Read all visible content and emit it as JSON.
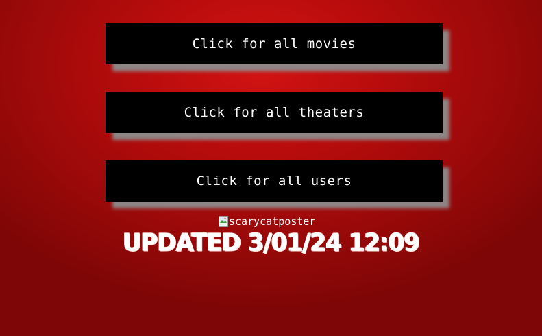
{
  "buttons": {
    "movies": "Click for all movies",
    "theaters": "Click for all theaters",
    "users": "Click for all users"
  },
  "poster": {
    "alt_text": "scarycatposter",
    "icon": "broken-image-icon"
  },
  "updated_text": "UPDATED 3/01/24 12:09",
  "colors": {
    "background": "#b80c0c",
    "button_bg": "#000000",
    "button_text": "#ffffff",
    "button_shadow": "#8c8c8c"
  }
}
